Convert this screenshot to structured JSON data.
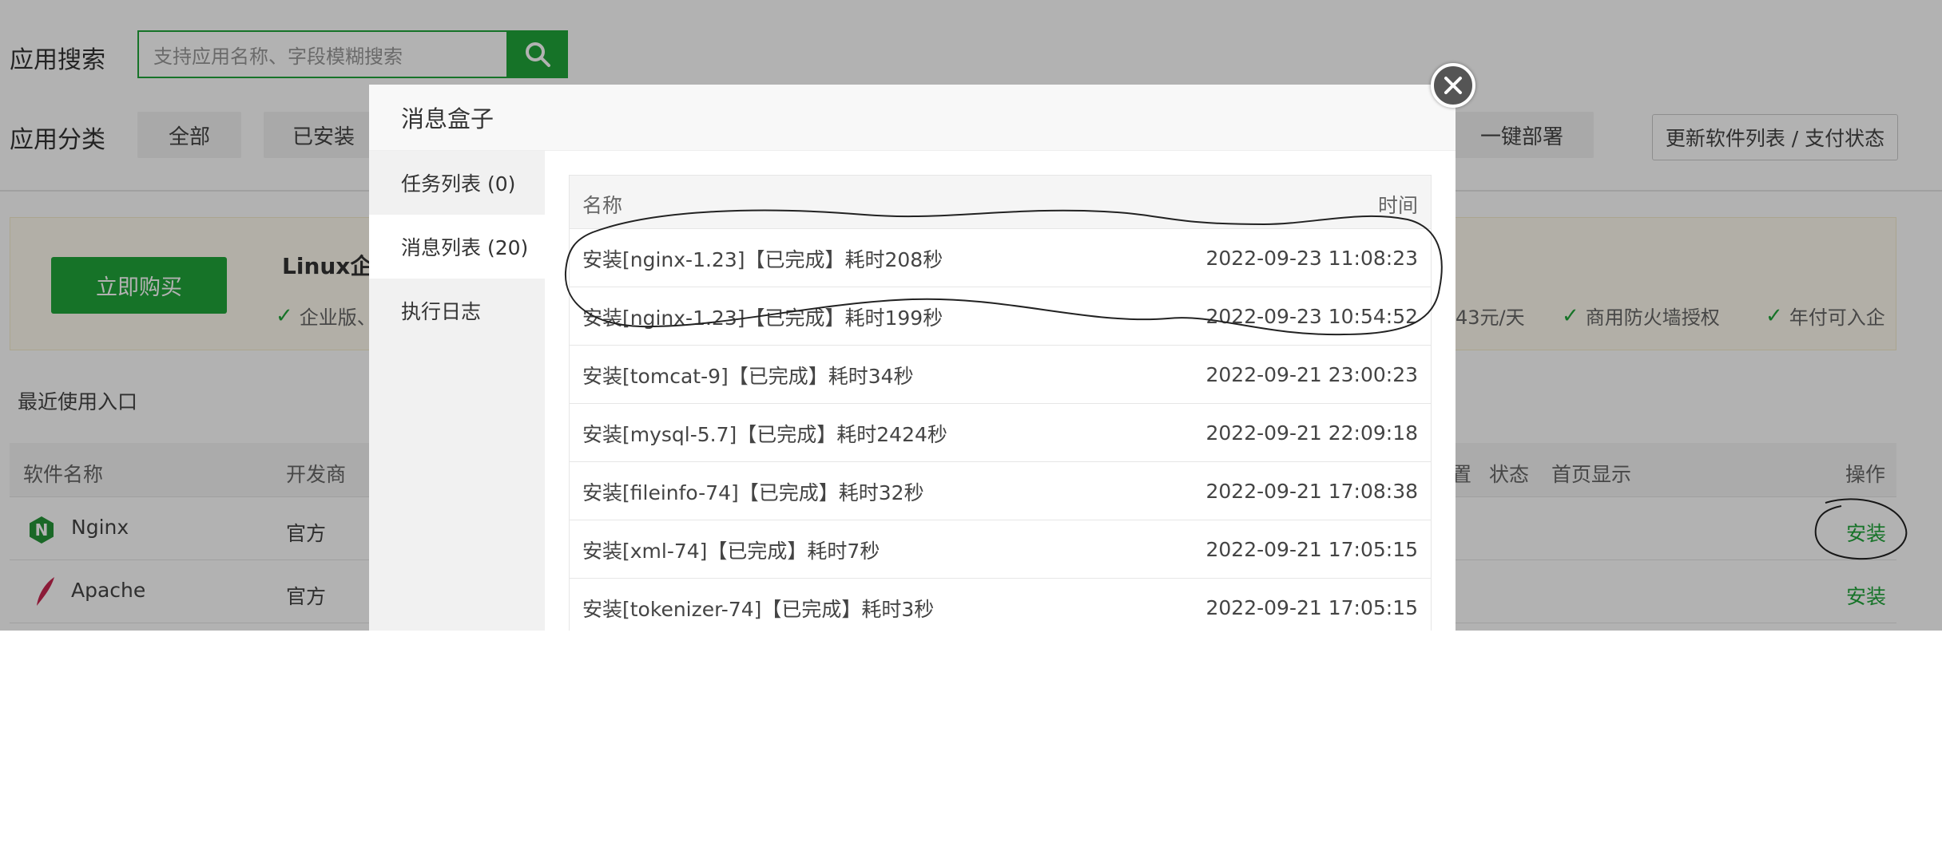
{
  "search": {
    "label": "应用搜索",
    "placeholder": "支持应用名称、字段模糊搜索"
  },
  "category": {
    "label": "应用分类",
    "buttons": [
      "全部",
      "已安装"
    ],
    "deploy": "一键部署",
    "update": "更新软件列表 / 支付状态"
  },
  "banner": {
    "buy": "立即购买",
    "title_partial": "Linux企",
    "features": [
      "企业版、",
      "43元/天",
      "商用防火墙授权",
      "年付可入企"
    ]
  },
  "recent": "最近使用入口",
  "table": {
    "headers": [
      "软件名称",
      "开发商",
      "置",
      "状态",
      "首页显示",
      "操作"
    ],
    "rows": [
      {
        "name": "Nginx",
        "vendor": "官方",
        "action": "安装"
      },
      {
        "name": "Apache",
        "vendor": "官方",
        "action": "安装"
      }
    ]
  },
  "modal": {
    "title": "消息盒子",
    "tabs": [
      "任务列表 (0)",
      "消息列表 (20)",
      "执行日志"
    ],
    "active_tab": "消息列表 (20)",
    "columns": {
      "name": "名称",
      "time": "时间"
    },
    "messages": [
      {
        "name": "安装[nginx-1.23]【已完成】耗时208秒",
        "time": "2022-09-23 11:08:23"
      },
      {
        "name": "安装[nginx-1.23]【已完成】耗时199秒",
        "time": "2022-09-23 10:54:52"
      },
      {
        "name": "安装[tomcat-9]【已完成】耗时34秒",
        "time": "2022-09-21 23:00:23"
      },
      {
        "name": "安装[mysql-5.7]【已完成】耗时2424秒",
        "time": "2022-09-21 22:09:18"
      },
      {
        "name": "安装[fileinfo-74]【已完成】耗时32秒",
        "time": "2022-09-21 17:08:38"
      },
      {
        "name": "安装[xml-74]【已完成】耗时7秒",
        "time": "2022-09-21 17:05:15"
      },
      {
        "name": "安装[tokenizer-74]【已完成】耗时3秒",
        "time": "2022-09-21 17:05:15"
      }
    ]
  },
  "colors": {
    "accent": "#20a53a",
    "overlay": "rgba(0,0,0,0.3)",
    "annotation": "#222222"
  },
  "icons": [
    "search-icon",
    "nginx-logo-icon",
    "apache-feather-icon",
    "close-icon",
    "check-icon"
  ]
}
